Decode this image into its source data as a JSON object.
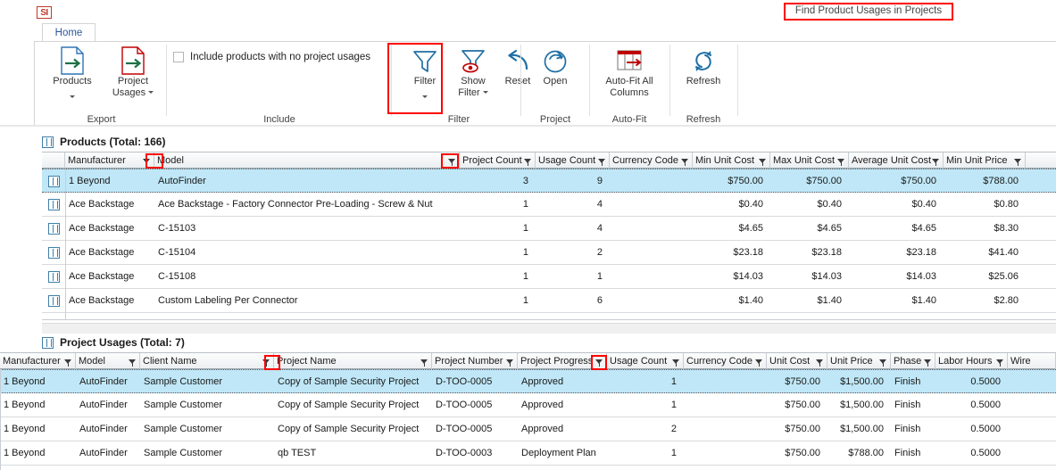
{
  "window": {
    "logo_text": "SI",
    "document_title": "Find Product Usages in Projects"
  },
  "ribbon": {
    "tabs": [
      {
        "label": "Home",
        "active": true
      }
    ],
    "groups": [
      {
        "name": "export",
        "label": "Export",
        "buttons": [
          {
            "name": "products",
            "label": "Products",
            "icon": "export-document-icon",
            "has_dropdown": true
          },
          {
            "name": "project-usages",
            "label_line1": "Project",
            "label_line2": "Usages",
            "icon": "export-document-icon",
            "has_dropdown": true
          }
        ]
      },
      {
        "name": "include",
        "label": "Include",
        "checkbox": {
          "label": "Include products with no project usages",
          "checked": false
        }
      },
      {
        "name": "filter",
        "label": "Filter",
        "buttons": [
          {
            "name": "filter",
            "label": "Filter",
            "icon": "funnel-icon",
            "has_dropdown": true,
            "highlighted": true
          },
          {
            "name": "show-filter",
            "label_line1": "Show",
            "label_line2": "Filter",
            "icon": "funnel-eye-icon",
            "has_dropdown": true
          },
          {
            "name": "reset",
            "label": "Reset",
            "icon": "undo-arrow-icon",
            "has_dropdown": false
          }
        ]
      },
      {
        "name": "project",
        "label": "Project",
        "buttons": [
          {
            "name": "open",
            "label": "Open",
            "icon": "open-circle-arrow-icon",
            "has_dropdown": false
          }
        ]
      },
      {
        "name": "auto-fit",
        "label": "Auto-Fit",
        "buttons": [
          {
            "name": "auto-fit-all-columns",
            "label_line1": "Auto-Fit All",
            "label_line2": "Columns",
            "icon": "autofit-columns-icon",
            "has_dropdown": false
          }
        ]
      },
      {
        "name": "refresh",
        "label": "Refresh",
        "buttons": [
          {
            "name": "refresh",
            "label": "Refresh",
            "icon": "refresh-circular-arrows-icon",
            "has_dropdown": false
          }
        ]
      }
    ]
  },
  "products_panel": {
    "title": "Products (Total: 166)",
    "columns": [
      {
        "key": "indicator",
        "label": "",
        "align": "left"
      },
      {
        "key": "manufacturer",
        "label": "Manufacturer",
        "align": "left"
      },
      {
        "key": "model",
        "label": "Model",
        "align": "left"
      },
      {
        "key": "project_count",
        "label": "Project Count",
        "align": "right"
      },
      {
        "key": "usage_count",
        "label": "Usage Count",
        "align": "right"
      },
      {
        "key": "currency_code",
        "label": "Currency Code",
        "align": "left"
      },
      {
        "key": "min_unit_cost",
        "label": "Min Unit Cost",
        "align": "right"
      },
      {
        "key": "max_unit_cost",
        "label": "Max Unit Cost",
        "align": "right"
      },
      {
        "key": "average_unit_cost",
        "label": "Average Unit Cost",
        "align": "right"
      },
      {
        "key": "min_unit_price",
        "label": "Min Unit Price",
        "align": "right"
      }
    ],
    "rows": [
      {
        "selected": true,
        "manufacturer": "1 Beyond",
        "model": "AutoFinder",
        "project_count": "3",
        "usage_count": "9",
        "currency_code": "",
        "min_unit_cost": "$750.00",
        "max_unit_cost": "$750.00",
        "average_unit_cost": "$750.00",
        "min_unit_price": "$788.00"
      },
      {
        "selected": false,
        "manufacturer": "Ace Backstage",
        "model": "Ace Backstage - Factory Connector Pre-Loading - Screw & Nut",
        "project_count": "1",
        "usage_count": "4",
        "currency_code": "",
        "min_unit_cost": "$0.40",
        "max_unit_cost": "$0.40",
        "average_unit_cost": "$0.40",
        "min_unit_price": "$0.80"
      },
      {
        "selected": false,
        "manufacturer": "Ace Backstage",
        "model": "C-15103",
        "project_count": "1",
        "usage_count": "4",
        "currency_code": "",
        "min_unit_cost": "$4.65",
        "max_unit_cost": "$4.65",
        "average_unit_cost": "$4.65",
        "min_unit_price": "$8.30"
      },
      {
        "selected": false,
        "manufacturer": "Ace Backstage",
        "model": "C-15104",
        "project_count": "1",
        "usage_count": "2",
        "currency_code": "",
        "min_unit_cost": "$23.18",
        "max_unit_cost": "$23.18",
        "average_unit_cost": "$23.18",
        "min_unit_price": "$41.40"
      },
      {
        "selected": false,
        "manufacturer": "Ace Backstage",
        "model": "C-15108",
        "project_count": "1",
        "usage_count": "1",
        "currency_code": "",
        "min_unit_cost": "$14.03",
        "max_unit_cost": "$14.03",
        "average_unit_cost": "$14.03",
        "min_unit_price": "$25.06"
      },
      {
        "selected": false,
        "manufacturer": "Ace Backstage",
        "model": "Custom Labeling Per Connector",
        "project_count": "1",
        "usage_count": "6",
        "currency_code": "",
        "min_unit_cost": "$1.40",
        "max_unit_cost": "$1.40",
        "average_unit_cost": "$1.40",
        "min_unit_price": "$2.80"
      }
    ]
  },
  "project_usages_panel": {
    "title": "Project Usages (Total: 7)",
    "columns": [
      {
        "key": "manufacturer",
        "label": "Manufacturer",
        "align": "left"
      },
      {
        "key": "model",
        "label": "Model",
        "align": "left"
      },
      {
        "key": "client_name",
        "label": "Client Name",
        "align": "left"
      },
      {
        "key": "project_name",
        "label": "Project Name",
        "align": "left"
      },
      {
        "key": "project_number",
        "label": "Project Number",
        "align": "left"
      },
      {
        "key": "project_progress",
        "label": "Project Progress",
        "align": "left"
      },
      {
        "key": "usage_count",
        "label": "Usage Count",
        "align": "right"
      },
      {
        "key": "currency_code",
        "label": "Currency Code",
        "align": "left"
      },
      {
        "key": "unit_cost",
        "label": "Unit Cost",
        "align": "right"
      },
      {
        "key": "unit_price",
        "label": "Unit Price",
        "align": "right"
      },
      {
        "key": "phase",
        "label": "Phase",
        "align": "left"
      },
      {
        "key": "labor_hours",
        "label": "Labor Hours",
        "align": "right"
      },
      {
        "key": "wire",
        "label": "Wire",
        "align": "left"
      }
    ],
    "rows": [
      {
        "selected": true,
        "manufacturer": "1 Beyond",
        "model": "AutoFinder",
        "client_name": "Sample Customer",
        "project_name": "Copy of Sample Security Project",
        "project_number": "D-TOO-0005",
        "project_progress": "Approved",
        "usage_count": "1",
        "currency_code": "",
        "unit_cost": "$750.00",
        "unit_price": "$1,500.00",
        "phase": "Finish",
        "labor_hours": "0.5000",
        "wire": ""
      },
      {
        "selected": false,
        "manufacturer": "1 Beyond",
        "model": "AutoFinder",
        "client_name": "Sample Customer",
        "project_name": "Copy of Sample Security Project",
        "project_number": "D-TOO-0005",
        "project_progress": "Approved",
        "usage_count": "1",
        "currency_code": "",
        "unit_cost": "$750.00",
        "unit_price": "$1,500.00",
        "phase": "Finish",
        "labor_hours": "0.5000",
        "wire": ""
      },
      {
        "selected": false,
        "manufacturer": "1 Beyond",
        "model": "AutoFinder",
        "client_name": "Sample Customer",
        "project_name": "Copy of Sample Security Project",
        "project_number": "D-TOO-0005",
        "project_progress": "Approved",
        "usage_count": "2",
        "currency_code": "",
        "unit_cost": "$750.00",
        "unit_price": "$1,500.00",
        "phase": "Finish",
        "labor_hours": "0.5000",
        "wire": ""
      },
      {
        "selected": false,
        "manufacturer": "1 Beyond",
        "model": "AutoFinder",
        "client_name": "Sample Customer",
        "project_name": "qb TEST",
        "project_number": "D-TOO-0003",
        "project_progress": "Deployment Plan",
        "usage_count": "1",
        "currency_code": "",
        "unit_cost": "$750.00",
        "unit_price": "$788.00",
        "phase": "Finish",
        "labor_hours": "0.5000",
        "wire": ""
      }
    ]
  },
  "colors": {
    "selection": "#bfe7f7",
    "annotation": "#ff0000",
    "tab_accent": "#2b579a",
    "icon_blue": "#2e75b6",
    "icon_red": "#c00000",
    "icon_green": "#1e7145"
  }
}
